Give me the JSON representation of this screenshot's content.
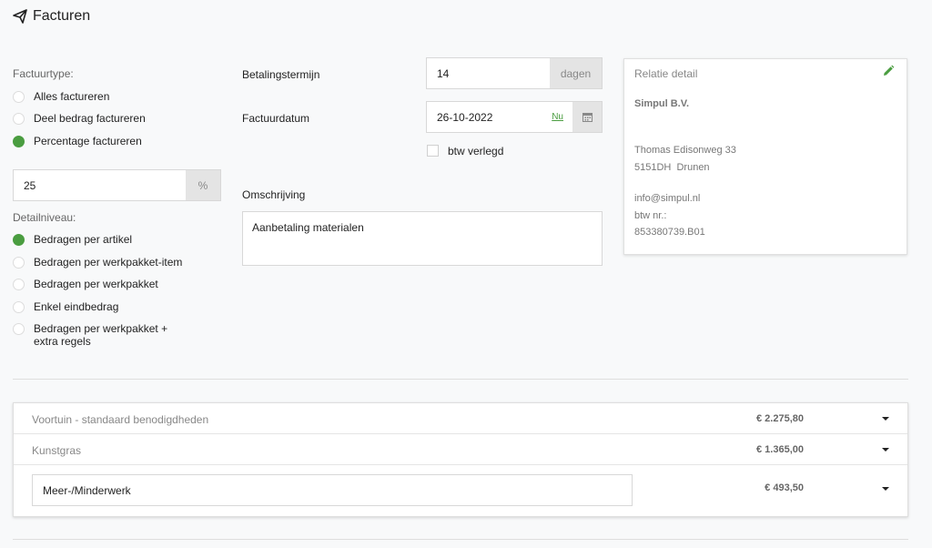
{
  "header": {
    "title": "Facturen",
    "icon": "paper-plane-icon"
  },
  "factuurtype": {
    "label": "Factuurtype:",
    "options": [
      {
        "label": "Alles factureren",
        "selected": false
      },
      {
        "label": "Deel bedrag factureren",
        "selected": false
      },
      {
        "label": "Percentage factureren",
        "selected": true
      }
    ],
    "percentage": {
      "value": "25",
      "unit": "%"
    }
  },
  "detailniveau": {
    "label": "Detailniveau:",
    "options": [
      {
        "label": "Bedragen per artikel",
        "selected": true
      },
      {
        "label": "Bedragen per werkpakket-item",
        "selected": false
      },
      {
        "label": "Bedragen per werkpakket",
        "selected": false
      },
      {
        "label": "Enkel eindbedrag",
        "selected": false
      },
      {
        "label": "Bedragen per werkpakket + extra regels",
        "selected": false
      }
    ]
  },
  "form": {
    "betalingstermijn": {
      "label": "Betalingstermijn",
      "value": "14",
      "unit": "dagen"
    },
    "factuurdatum": {
      "label": "Factuurdatum",
      "value": "26-10-2022",
      "now_link": "Nu"
    },
    "btw_verlegd": {
      "label": "btw verlegd",
      "checked": false
    },
    "omschrijving": {
      "label": "Omschrijving",
      "value": "Aanbetaling materialen"
    }
  },
  "relatie": {
    "title": "Relatie detail",
    "name": "Simpul B.V.",
    "street": "Thomas Edisonweg 33",
    "postcode_city": "5151DH  Drunen",
    "email": "info@simpul.nl",
    "btw_label": "btw nr.:",
    "btw_number": "853380739.B01"
  },
  "lines": [
    {
      "name": "Voortuin - standaard benodigdheden",
      "amount": "€ 2.275,80"
    },
    {
      "name": "Kunstgras",
      "amount": "€ 1.365,00"
    },
    {
      "name": "Meer-/Minderwerk",
      "amount": "€ 493,50",
      "editable": true
    }
  ],
  "colors": {
    "accent": "#4a9d40",
    "addon_bg": "#e4e4e4",
    "border": "#d8d8d8"
  }
}
